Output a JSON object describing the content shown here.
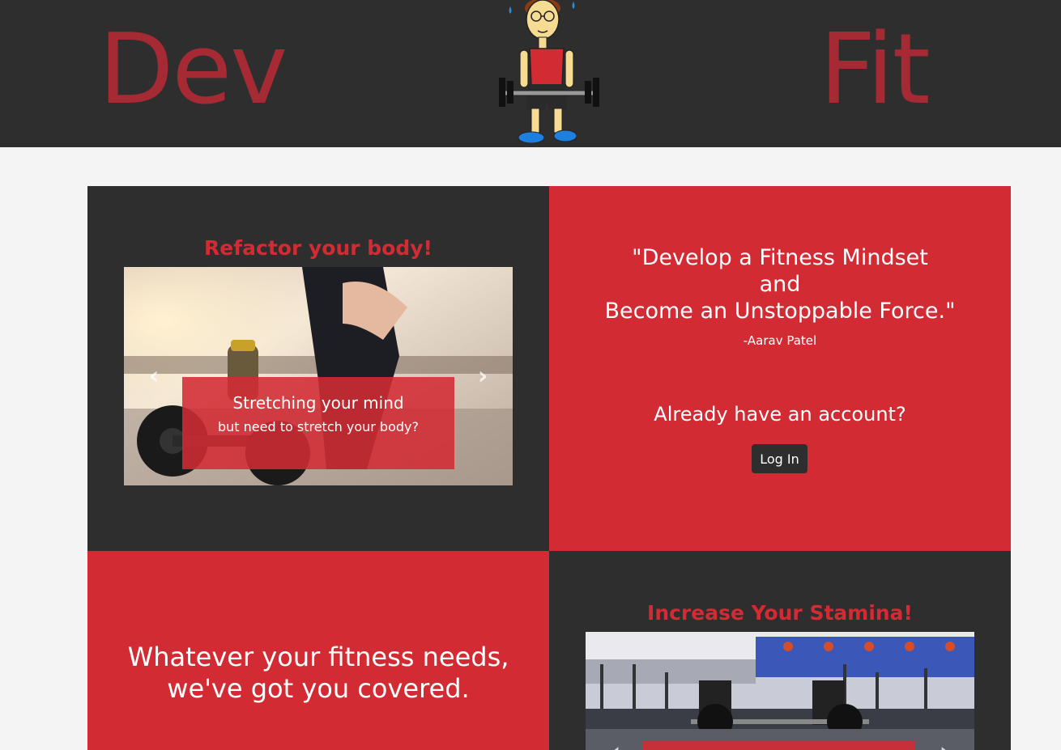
{
  "header": {
    "brand_left": "Dev",
    "brand_right": "Fit",
    "mascot_icon": "weightlifter-mascot-icon"
  },
  "colors": {
    "dark": "#2e2e2e",
    "red": "#d22b33",
    "brand": "#a52a33",
    "background": "#f4f4f4"
  },
  "carousel_1": {
    "title": "Refactor your body!",
    "caption_title": "Stretching your mind",
    "caption_sub": "but need to stretch your body?",
    "prev": "‹",
    "next": "›"
  },
  "quote": {
    "line1": "\"Develop a Fitness Mindset",
    "line2": "and",
    "line3": "Become an Unstoppable Force.\"",
    "author": "-Aarav Patel"
  },
  "account": {
    "question": "Already have an account?",
    "login_label": "Log In"
  },
  "tagline": {
    "line1": "Whatever your fitness needs,",
    "line2": "we've got you covered."
  },
  "carousel_2": {
    "title": "Increase Your Stamina!",
    "prev": "‹",
    "next": "›"
  }
}
